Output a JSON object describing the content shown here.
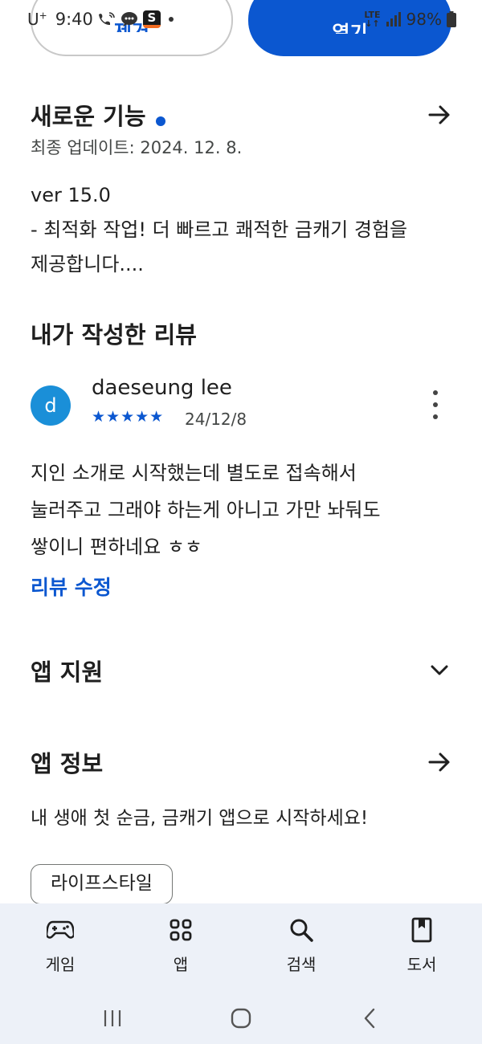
{
  "status_bar": {
    "carrier": "U",
    "carrier_sup": "+",
    "time": "9:40",
    "network": "LTE",
    "battery": "98%"
  },
  "top_buttons": {
    "remove_label": "제거",
    "open_label": "열기"
  },
  "whats_new": {
    "title": "새로운 기능",
    "updated": "최종 업데이트: 2024. 12. 8.",
    "version": "ver 15.0",
    "line1": "- 최적화 작업! 더 빠르고 쾌적한 금캐기 경험을",
    "line2": "제공합니다...."
  },
  "my_review": {
    "title": "내가 작성한 리뷰",
    "avatar_letter": "d",
    "reviewer": "daeseung lee",
    "stars": "★★★★★",
    "rating": 5,
    "date": "24/12/8",
    "body_line1": "지인 소개로 시작했는데 별도로 접속해서",
    "body_line2": "눌러주고 그래야 하는게 아니고 가만 놔둬도",
    "body_line3": "쌓이니 편하네요 ㅎㅎ",
    "edit_label": "리뷰 수정"
  },
  "app_support": {
    "title": "앱 지원"
  },
  "app_info": {
    "title": "앱 정보",
    "description": "내 생애 첫 순금, 금캐기 앱으로 시작하세요!",
    "category_chip": "라이프스타일"
  },
  "bottom_nav": {
    "items": [
      {
        "label": "게임",
        "icon": "gamepad-icon"
      },
      {
        "label": "앱",
        "icon": "apps-grid-icon"
      },
      {
        "label": "검색",
        "icon": "search-icon"
      },
      {
        "label": "도서",
        "icon": "book-icon"
      }
    ]
  },
  "colors": {
    "accent": "#0b57d0",
    "nav_bg": "#edf1f8",
    "avatar": "#1a8fd8"
  }
}
